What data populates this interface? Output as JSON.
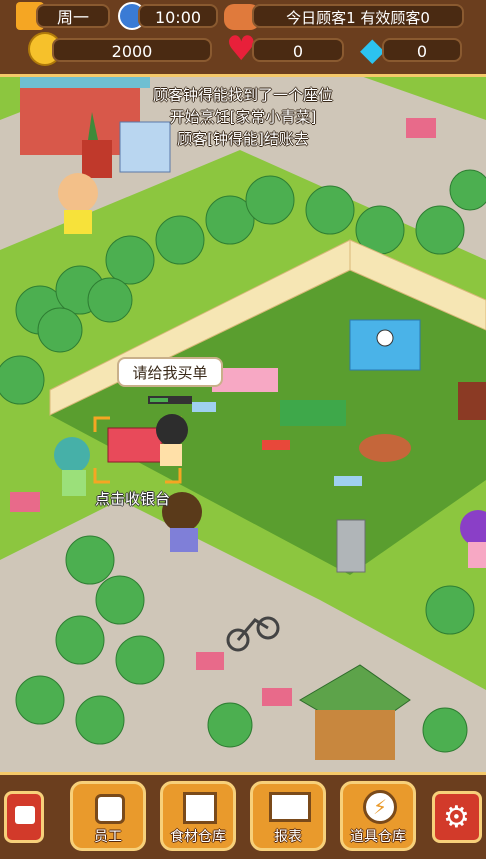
{
  "hud": {
    "day": "周一",
    "time": "10:00",
    "customers": "今日顾客1 有效顾客0",
    "coins": "2000",
    "hearts": "0",
    "diamonds": "0"
  },
  "log": [
    "顾客钟得能找到了一个座位",
    "开始烹饪[家常小青菜]",
    "顾客[钟得能]结账去"
  ],
  "bubble": "请给我买单",
  "hint": "点击收银台",
  "toolbar": {
    "staff": "员工",
    "ingredients": "食材仓库",
    "report": "报表",
    "props": "道具仓库"
  }
}
